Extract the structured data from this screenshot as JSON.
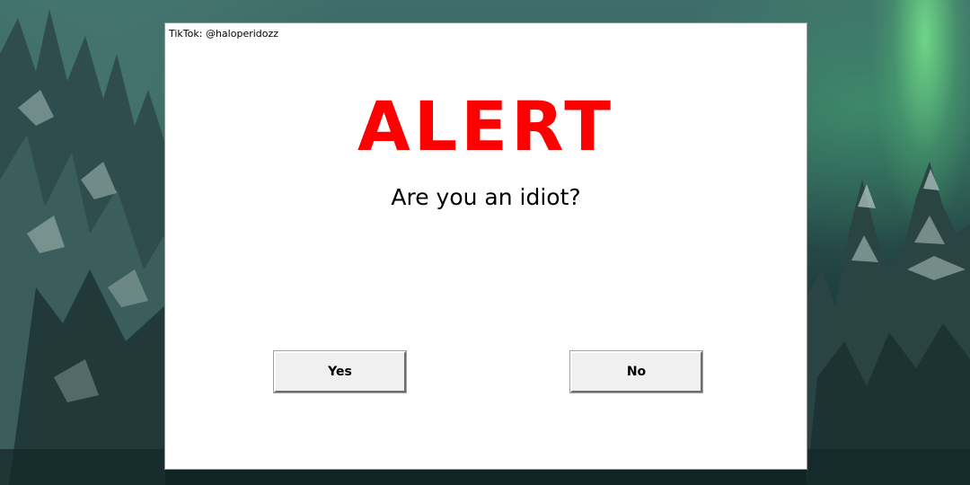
{
  "window": {
    "caption": "TikTok: @haloperidozz"
  },
  "alert": {
    "title": "ALERT",
    "title_color": "#ff0000",
    "question": "Are you an idiot?"
  },
  "buttons": {
    "yes_label": "Yes",
    "no_label": "No"
  },
  "colors": {
    "window_background": "#ffffff",
    "button_face": "#f0f0f0",
    "aurora": "#78e68c"
  }
}
